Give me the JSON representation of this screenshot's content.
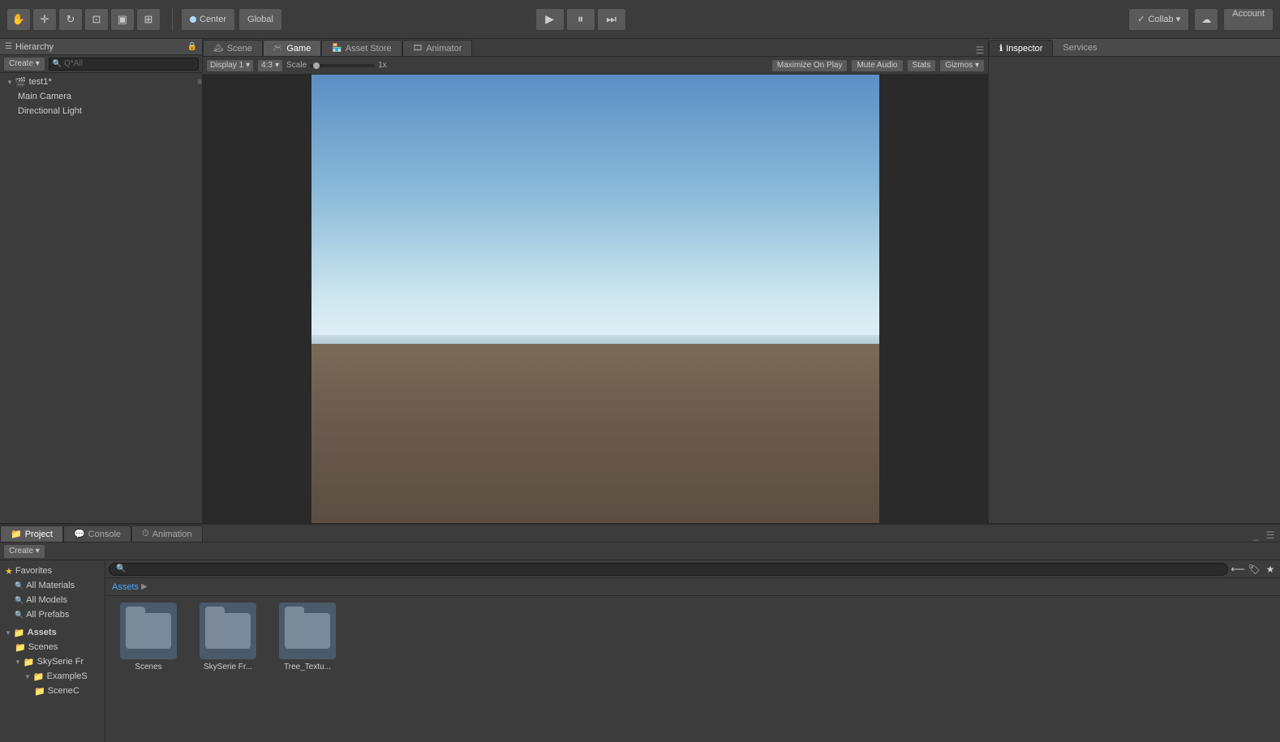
{
  "toolbar": {
    "tools": [
      {
        "id": "hand",
        "icon": "✋",
        "label": "Hand Tool"
      },
      {
        "id": "move",
        "icon": "✛",
        "label": "Move Tool"
      },
      {
        "id": "rotate",
        "icon": "↻",
        "label": "Rotate Tool"
      },
      {
        "id": "scale",
        "icon": "⊡",
        "label": "Scale Tool"
      },
      {
        "id": "rect",
        "icon": "▣",
        "label": "Rect Tool"
      },
      {
        "id": "transform",
        "icon": "⊞",
        "label": "Transform Tool"
      }
    ],
    "pivot_center": "Center",
    "pivot_global": "Global",
    "play_icon": "▶",
    "pause_icon": "⏸",
    "step_icon": "⏭",
    "collab_label": "Collab ▾",
    "cloud_icon": "☁",
    "account_label": "Account"
  },
  "hierarchy": {
    "title": "Hierarchy",
    "create_label": "Create ▾",
    "search_placeholder": "Q*All",
    "items": [
      {
        "id": "test1",
        "label": "test1*",
        "depth": 0,
        "has_children": true,
        "icon": "🎬"
      },
      {
        "id": "main-camera",
        "label": "Main Camera",
        "depth": 1
      },
      {
        "id": "directional-light",
        "label": "Directional Light",
        "depth": 1
      }
    ]
  },
  "viewport": {
    "tabs": [
      {
        "id": "scene",
        "label": "Scene",
        "icon": "🏔",
        "active": false
      },
      {
        "id": "game",
        "label": "Game",
        "icon": "🎮",
        "active": true
      },
      {
        "id": "asset-store",
        "label": "Asset Store",
        "icon": "🏪",
        "active": false
      },
      {
        "id": "animator",
        "label": "Animator",
        "icon": "🎞",
        "active": false
      }
    ],
    "display_label": "Display 1",
    "aspect_label": "4:3",
    "scale_label": "Scale",
    "scale_value": "1x",
    "maximize_label": "Maximize On Play",
    "mute_label": "Mute Audio",
    "stats_label": "Stats",
    "gizmos_label": "Gizmos ▾"
  },
  "inspector": {
    "tabs": [
      {
        "id": "inspector",
        "label": "Inspector",
        "icon": "ℹ",
        "active": true
      },
      {
        "id": "services",
        "label": "Services",
        "active": false
      }
    ]
  },
  "bottom": {
    "tabs": [
      {
        "id": "project",
        "label": "Project",
        "icon": "📁",
        "active": true
      },
      {
        "id": "console",
        "label": "Console",
        "icon": "💬",
        "active": false
      },
      {
        "id": "animation",
        "label": "Animation",
        "icon": "⏱",
        "active": false
      }
    ],
    "create_label": "Create ▾",
    "search_placeholder": "",
    "favorites": {
      "title": "Favorites",
      "items": [
        {
          "label": "All Materials",
          "icon": "🔍"
        },
        {
          "label": "All Models",
          "icon": "🔍"
        },
        {
          "label": "All Prefabs",
          "icon": "🔍"
        }
      ]
    },
    "assets": {
      "title": "Assets",
      "items": [
        {
          "label": "Scenes",
          "icon": "folder"
        },
        {
          "label": "SkySerie Fr",
          "icon": "folder",
          "has_children": true
        },
        {
          "label": "ExampleS",
          "icon": "folder",
          "depth": 1
        },
        {
          "label": "SceneC",
          "icon": "folder",
          "depth": 2
        }
      ]
    },
    "asset_items": [
      {
        "label": "Scenes",
        "type": "folder"
      },
      {
        "label": "SkySerie Fr...",
        "type": "folder"
      },
      {
        "label": "Tree_Textu...",
        "type": "folder"
      }
    ]
  }
}
